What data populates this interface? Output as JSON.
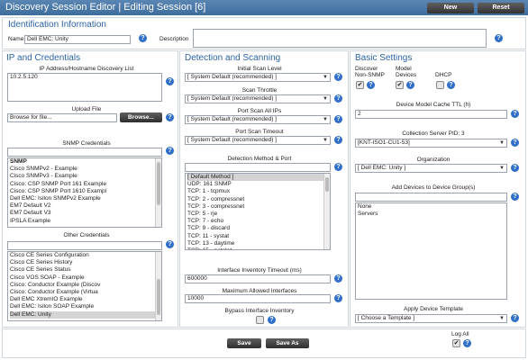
{
  "window": {
    "title": "Discovery Session Editor | Editing Session [6]",
    "new_label": "New",
    "reset_label": "Reset"
  },
  "identification": {
    "heading": "Identification Information",
    "name_label": "Name",
    "name_value": "Dell EMC: Unity",
    "description_label": "Description",
    "description_value": ""
  },
  "ip": {
    "heading": "IP and Credentials",
    "discovery_list_label": "IP Address/Hostname Discovery List",
    "discovery_list_value": "10.2.5.120",
    "upload_label": "Upload File",
    "upload_placeholder": "Browse for file...",
    "browse_label": "Browse...",
    "snmp_label": "SNMP Credentials",
    "snmp_items": [
      "SNMP",
      "Cisco SNMPv2 - Example",
      "Cisco SNMPv3 - Example",
      "Cisco: CSP SNMP Port 161 Example",
      "Cisco: CSP SNMP Port 1610 Exampl",
      "Dell EMC: Isilon SNMPv2 Example",
      "EM7 Default V2",
      "EM7 Default V3",
      "IPSLA Example"
    ],
    "other_label": "Other Credentials",
    "other_items": [
      "Cisco CE Series Configuration",
      "Cisco CE Series History",
      "Cisco CE Series Status",
      "Cisco VOS SOAP - Example",
      "Cisco: Conductor Example (Discov",
      "Cisco: Conductor Example (Virtua",
      "Dell EMC XtremIO Example",
      "Dell EMC: Isilon SOAP Example",
      "Dell EMC: Unity"
    ]
  },
  "detection": {
    "heading": "Detection and Scanning",
    "initial_scan_label": "Initial Scan Level",
    "initial_scan_value": "[ System Default (recommended) ]",
    "scan_throttle_label": "Scan Throttle",
    "scan_throttle_value": "[ System Default (recommended) ]",
    "port_scan_all_label": "Port Scan All IPs",
    "port_scan_all_value": "[ System Default (recommended) ]",
    "port_scan_timeout_label": "Port Scan Timeout",
    "port_scan_timeout_value": "[ System Default (recommended) ]",
    "method_label": "Detection Method & Port",
    "methods": [
      "[ Default Method ]",
      "UDP: 161 SNMP",
      "TCP: 1 - tcpmux",
      "TCP: 2 - compressnet",
      "TCP: 3 - compressnet",
      "TCP: 5 - rje",
      "TCP: 7 - echo",
      "TCP: 9 - discard",
      "TCP: 11 - systat",
      "TCP: 13 - daytime",
      "TCP: 15 - netstat"
    ],
    "inventory_timeout_label": "Interface Inventory Timeout (ms)",
    "inventory_timeout_value": "600000",
    "max_interfaces_label": "Maximum Allowed Interfaces",
    "max_interfaces_value": "10000",
    "bypass_label": "Bypass Interface Inventory"
  },
  "basic": {
    "heading": "Basic Settings",
    "discover_nonsnmp_label": "Discover Non-SNMP",
    "model_devices_label": "Model Devices",
    "dhcp_label": "DHCP",
    "cache_ttl_label": "Device Model Cache TTL (h)",
    "cache_ttl_value": "2",
    "collection_label": "Collection Server PID: 3",
    "collection_value": "[KNT-ISO1-CU1-53]",
    "org_label": "Organization",
    "org_value": "[ Dell EMC: Unity ]",
    "groups_label": "Add Devices to Device Group(s)",
    "groups": [
      "None",
      "Servers"
    ],
    "template_label": "Apply Device Template",
    "template_value": "[ Choose a Template ]"
  },
  "footer": {
    "save_label": "Save",
    "save_as_label": "Save As",
    "log_all_label": "Log All"
  },
  "icons": {
    "help": "?",
    "check": "✔"
  }
}
